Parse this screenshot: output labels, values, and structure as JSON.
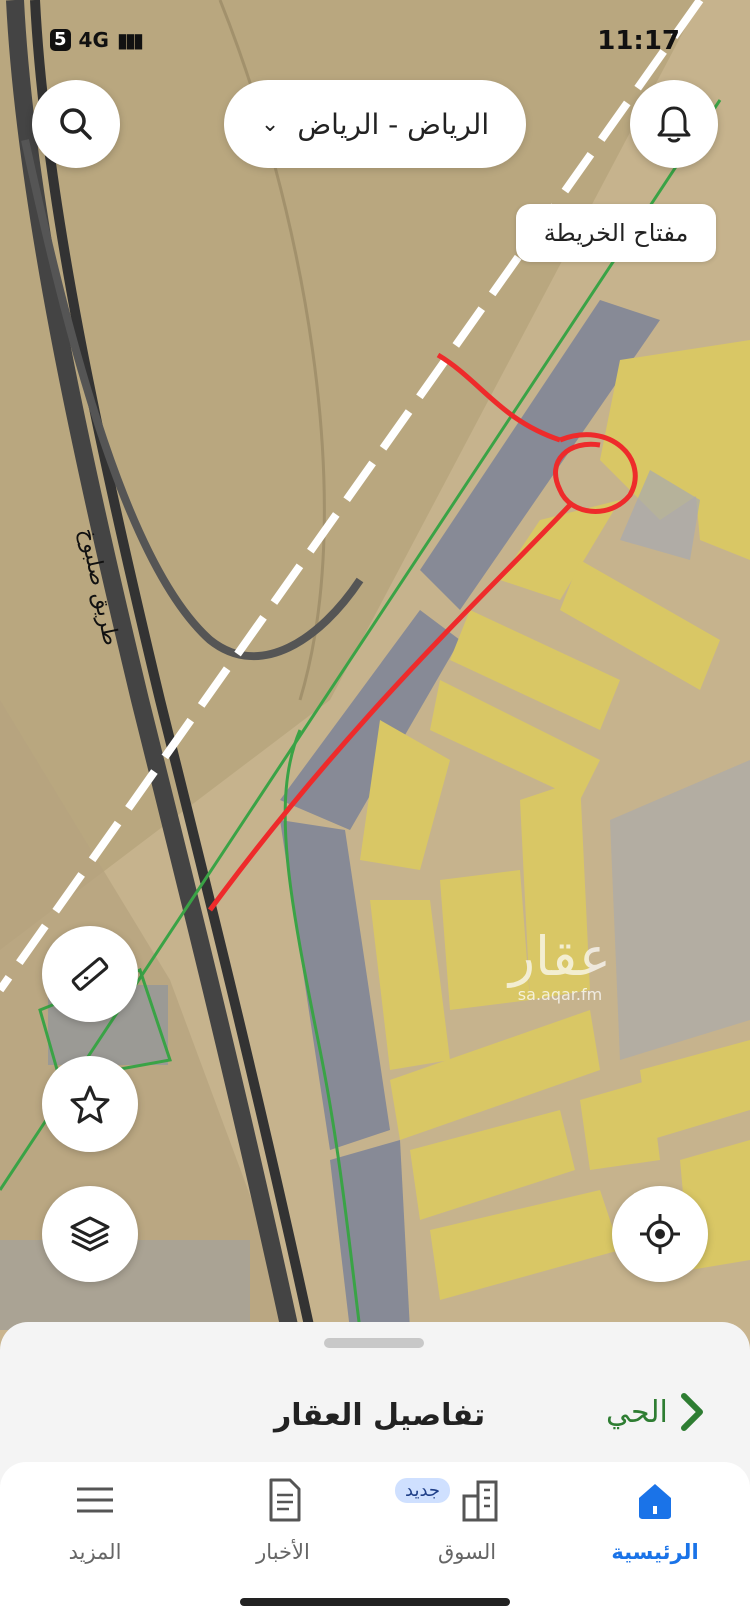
{
  "status_bar": {
    "carrier_badge": "5",
    "network": "4G",
    "time": "11:17"
  },
  "header": {
    "city_selector": "الرياض - الرياض"
  },
  "map": {
    "key_button": "مفتاح الخريطة",
    "road_label": "طريق صلبوخ",
    "watermark_main": "عقار",
    "watermark_sub": "sa.aqar.fm"
  },
  "sheet": {
    "title": "تفاصيل العقار",
    "district_link": "الحي"
  },
  "nav": {
    "home": "الرئيسية",
    "market": "السوق",
    "market_badge": "جديد",
    "news": "الأخبار",
    "more": "المزيد"
  },
  "colors": {
    "accent": "#1a73e8",
    "link_green": "#2e7d32",
    "plot_yellow": "#d9c765",
    "plot_gray": "#7f8597"
  }
}
